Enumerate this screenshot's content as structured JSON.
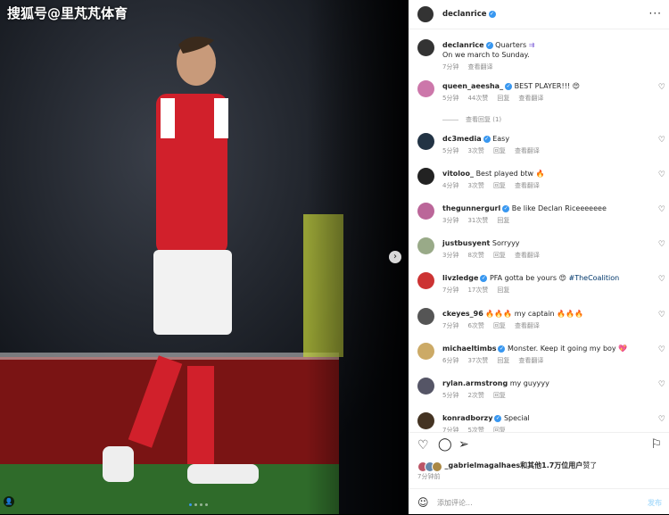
{
  "watermark": "搜狐号@里芃芃体育",
  "post": {
    "author": "declanrice",
    "caption_text": "Quarters ⛹ On we march to Sunday.",
    "caption_line1": "Quarters",
    "caption_emoji": "⇉",
    "caption_line2": "On we march to Sunday.",
    "caption_time": "7分钟",
    "caption_translate": "查看翻译"
  },
  "comments": [
    {
      "user": "queen_aeesha_",
      "verified": true,
      "text": "BEST PLAYER!!! 😍",
      "time": "5分钟",
      "likes": "44次赞",
      "reply": "回复",
      "translate": "查看翻译"
    },
    {
      "user": "dc3media",
      "verified": true,
      "text": "Easy",
      "time": "5分钟",
      "likes": "3次赞",
      "reply": "回复",
      "translate": "查看翻译"
    },
    {
      "user": "vitoloo_",
      "verified": false,
      "text": "Best played btw 🔥",
      "time": "4分钟",
      "likes": "3次赞",
      "reply": "回复",
      "translate": "查看翻译"
    },
    {
      "user": "thegunnergurl",
      "verified": true,
      "text": "Be like Declan Riceeeeeee",
      "time": "3分钟",
      "likes": "31次赞",
      "reply": "回复",
      "translate": ""
    },
    {
      "user": "justbusyent",
      "verified": false,
      "text": "Sorryyy",
      "time": "3分钟",
      "likes": "8次赞",
      "reply": "回复",
      "translate": "查看翻译"
    },
    {
      "user": "livzledge",
      "verified": true,
      "text": "PFA gotta be yours 😍",
      "mention": "#TheCoalition",
      "time": "7分钟",
      "likes": "17次赞",
      "reply": "回复",
      "translate": ""
    },
    {
      "user": "ckeyes_96",
      "verified": false,
      "text": "🔥🔥🔥 my captain 🔥🔥🔥",
      "time": "7分钟",
      "likes": "6次赞",
      "reply": "回复",
      "translate": "查看翻译"
    },
    {
      "user": "michaeltimbs",
      "verified": true,
      "text": "Monster. Keep it going my boy 💖",
      "time": "6分钟",
      "likes": "37次赞",
      "reply": "回复",
      "translate": "查看翻译"
    },
    {
      "user": "rylan.armstrong",
      "verified": false,
      "text": "my guyyyy",
      "time": "5分钟",
      "likes": "2次赞",
      "reply": "回复",
      "translate": ""
    },
    {
      "user": "konradborzy",
      "verified": true,
      "text": "Special",
      "time": "7分钟",
      "likes": "5次赞",
      "reply": "回复",
      "translate": ""
    }
  ],
  "view_replies": "查看回复 (1)",
  "likes_line": {
    "user": "_gabrielmagalhaes",
    "rest": "和其他1.7万位用户",
    "suffix": "赞了"
  },
  "post_time": "7分钟前",
  "add_comment": {
    "placeholder": "添加评论...",
    "post_label": "发布"
  },
  "icons": {
    "heart": "heart-icon",
    "comment": "comment-icon",
    "share": "share-icon",
    "save": "bookmark-icon",
    "emoji": "emoji-icon"
  }
}
